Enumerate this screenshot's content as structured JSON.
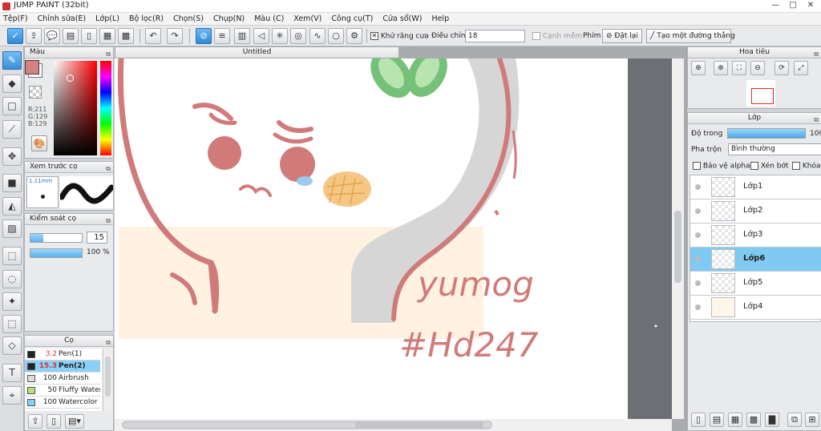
{
  "window": {
    "title": "JUMP PAINT (32bit)",
    "minimize": "—",
    "maximize": "□",
    "close": "✕"
  },
  "menu": [
    "Tệp(F)",
    "Chỉnh sửa(E)",
    "Lớp(L)",
    "Bộ lọc(R)",
    "Chọn(S)",
    "Chụp(N)",
    "Màu (C)",
    "Xem(V)",
    "Công cụ(T)",
    "Cửa sổ(W)",
    "Help"
  ],
  "toolbar": {
    "antialias_label": "Khử răng cưa",
    "adjust_label": "Điều chỉnh",
    "adjust_value": "18",
    "edge_label": "Cạnh mềm",
    "keys_label": "Phím",
    "reset_label": "Đặt lại",
    "straight_line_label": "Tạo một đường thẳng"
  },
  "color_panel": {
    "title": "Màu",
    "r": "R:211",
    "g": "G:129",
    "b": "B:129",
    "main_color": "#d38181"
  },
  "brush_preview": {
    "title": "Xem trước cọ",
    "size": "1.11mm"
  },
  "brush_control": {
    "title": "Kiểm soát cọ",
    "size_value": "15",
    "opacity_value": "100 %",
    "size_fill": 0.25,
    "opacity_fill": 1.0
  },
  "brush_panel": {
    "title": "Cọ",
    "items": [
      {
        "size": "3.2",
        "name": "Pen(1)",
        "color": "#222222",
        "selected": false
      },
      {
        "size": "15.3",
        "name": "Pen(2)",
        "color": "#222222",
        "selected": true
      },
      {
        "size": "100",
        "name": "Airbrush",
        "color": "#dddddd",
        "selected": false
      },
      {
        "size": "50",
        "name": "Fluffy Water",
        "color": "#b9e07a",
        "selected": false
      },
      {
        "size": "100",
        "name": "Watercolor (",
        "color": "#7fd3f0",
        "selected": false
      }
    ]
  },
  "canvas": {
    "tab_title": "Untitled",
    "text1": "yumog",
    "text2": "#Hd247"
  },
  "navigator": {
    "title": "Hoa tiêu"
  },
  "layer_panel": {
    "title": "Lớp",
    "opacity_label": "Độ trong",
    "opacity_value": "100",
    "opacity_fill": 1.0,
    "blend_label": "Pha trộn",
    "blend_value": "Bình thường",
    "protect_alpha": "Bảo vệ alpha",
    "clipping": "Xén bớt",
    "lock": "Khóa",
    "layers": [
      {
        "name": "Lớp1",
        "selected": false
      },
      {
        "name": "Lớp2",
        "selected": false
      },
      {
        "name": "Lớp3",
        "selected": false
      },
      {
        "name": "Lớp6",
        "selected": true
      },
      {
        "name": "Lớp5",
        "selected": false
      },
      {
        "name": "Lớp4",
        "selected": false
      }
    ]
  }
}
